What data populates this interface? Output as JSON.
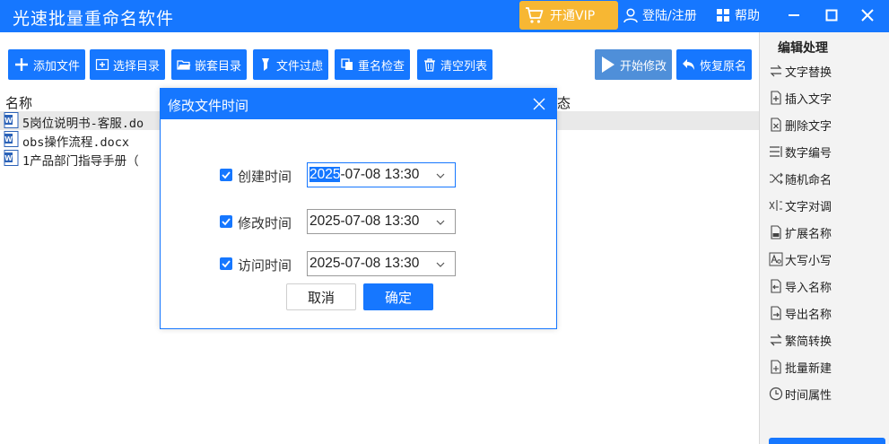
{
  "app": {
    "title": "光速批量重命名软件",
    "vip_label": "开通VIP",
    "login_label": "登陆/注册",
    "help_label": "帮助"
  },
  "toolbar": {
    "add_file": "添加文件",
    "select_dir": "选择目录",
    "nested_dir": "嵌套目录",
    "file_filter": "文件过虑",
    "rename_check": "重名检查",
    "clear_list": "清空列表",
    "start_modify": "开始修改",
    "restore_name": "恢复原名"
  },
  "file_list": {
    "col_name": "名称",
    "col_status": "态",
    "files": [
      "5岗位说明书-客服.do",
      "obs操作流程.docx",
      "1产品部门指导手册（"
    ]
  },
  "sidebar": {
    "title": "编辑处理",
    "items": [
      "文字替换",
      "插入文字",
      "删除文字",
      "数字编号",
      "随机命名",
      "文字对调",
      "扩展名称",
      "大写小写",
      "导入名称",
      "导出名称",
      "繁简转换",
      "批量新建",
      "时间属性"
    ]
  },
  "dialog": {
    "title": "修改文件时间",
    "options": [
      {
        "label": "创建时间",
        "year": "2025",
        "rest": "-07-08 13:30",
        "checked": true
      },
      {
        "label": "修改时间",
        "year": "",
        "rest": "2025-07-08 13:30",
        "checked": true
      },
      {
        "label": "访问时间",
        "year": "",
        "rest": "2025-07-08 13:30",
        "checked": true
      }
    ],
    "cancel_label": "取消",
    "ok_label": "确定"
  },
  "colors": {
    "primary": "#1677ff",
    "vip": "#f7b733",
    "sidebar_bg": "#f3f3f3",
    "selected_row": "#e9e9e9"
  }
}
